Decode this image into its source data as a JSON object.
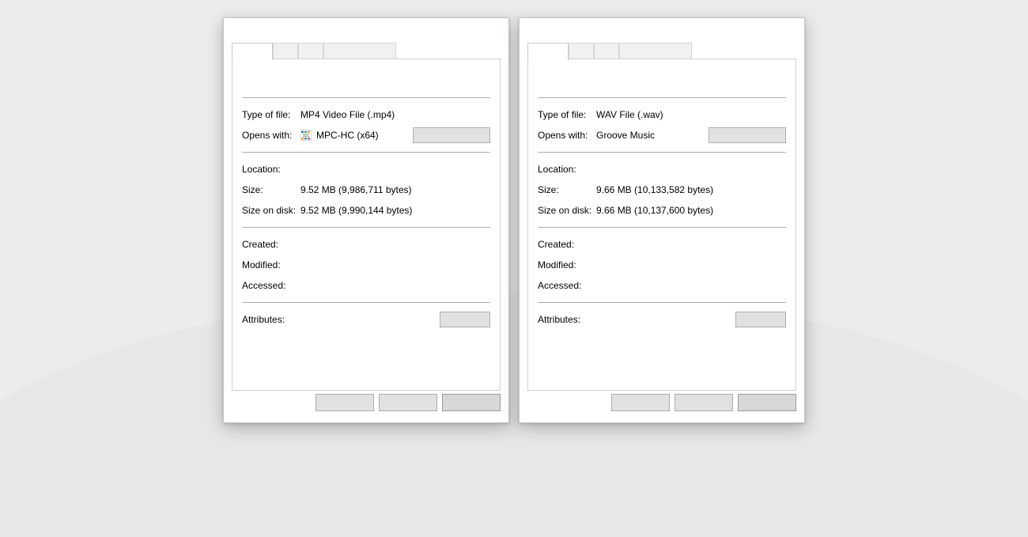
{
  "labels": {
    "type_of_file": "Type of file:",
    "opens_with": "Opens with:",
    "location": "Location:",
    "size": "Size:",
    "size_on_disk": "Size on disk:",
    "created": "Created:",
    "modified": "Modified:",
    "accessed": "Accessed:",
    "attributes": "Attributes:"
  },
  "left": {
    "type_of_file": "MP4 Video File (.mp4)",
    "opens_with": "MPC-HC (x64)",
    "opens_with_has_icon": true,
    "location": "",
    "size": "9.52 MB (9,986,711 bytes)",
    "size_on_disk": "9.52 MB (9,990,144 bytes)",
    "created": "",
    "modified": "",
    "accessed": "",
    "attributes": ""
  },
  "right": {
    "type_of_file": "WAV File (.wav)",
    "opens_with": "Groove Music",
    "opens_with_has_icon": false,
    "location": "",
    "size": "9.66 MB (10,133,582 bytes)",
    "size_on_disk": "9.66 MB (10,137,600 bytes)",
    "created": "",
    "modified": "",
    "accessed": "",
    "attributes": ""
  }
}
